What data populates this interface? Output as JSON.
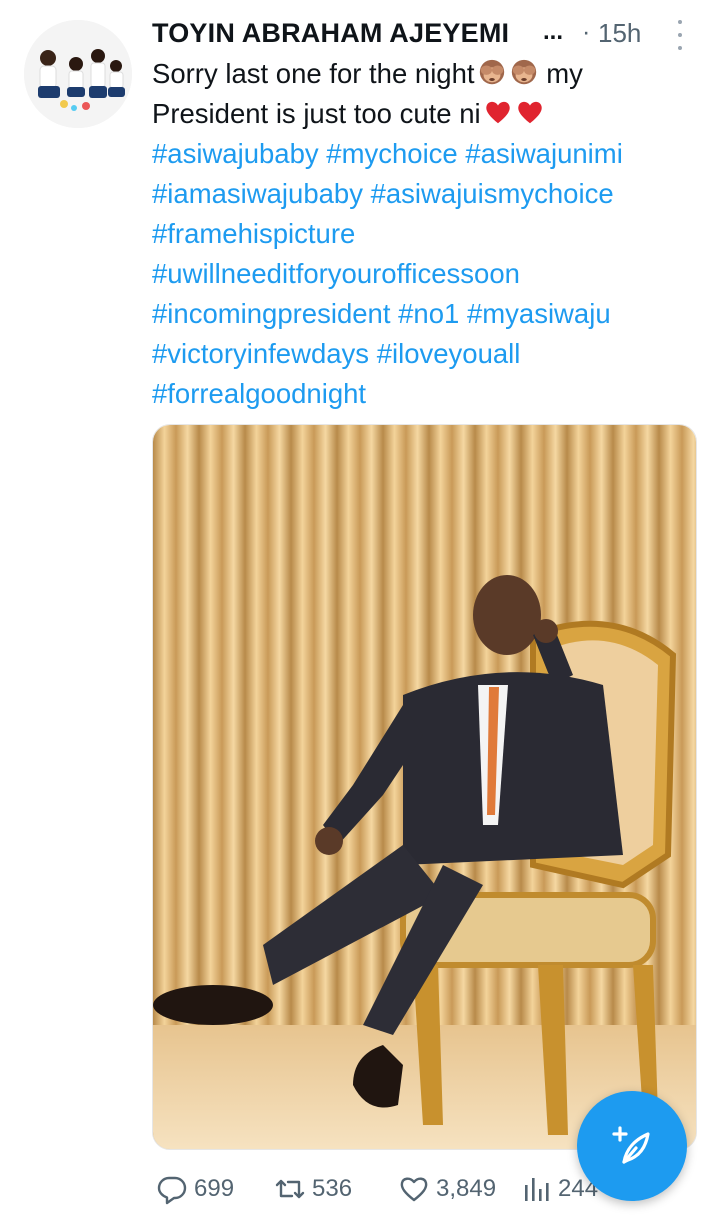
{
  "tweet": {
    "author_name": "TOYIN ABRAHAM AJEYEMI",
    "name_truncation": "...",
    "separator": "·",
    "time": "15h",
    "text_line1": "Sorry last one for the night",
    "text_line1_after": "my",
    "text_line2": "President is just too cute ni",
    "emojis": [
      "see-no-evil-monkey",
      "see-no-evil-monkey",
      "red-heart",
      "red-heart"
    ],
    "hashtag_lines": [
      [
        "#asiwajubaby",
        "#mychoice",
        "#asiwajunimi"
      ],
      [
        "#iamasiwajubaby",
        "#asiwajuismychoice"
      ],
      [
        "#framehispicture"
      ],
      [
        "#uwillneeditforyourofficessoon"
      ],
      [
        "#incomingpresident",
        "#no1",
        "#myasiwaju"
      ],
      [
        "#victoryinfewdays",
        "#iloveyouall"
      ],
      [
        "#forrealgoodnight"
      ]
    ]
  },
  "actions": {
    "replies": "699",
    "retweets": "536",
    "likes": "3,849",
    "views": "244"
  },
  "fab": {
    "icon": "compose-tweet-icon"
  },
  "colors": {
    "link": "#1d9bf0",
    "muted": "#536471",
    "text": "#0f1419"
  }
}
